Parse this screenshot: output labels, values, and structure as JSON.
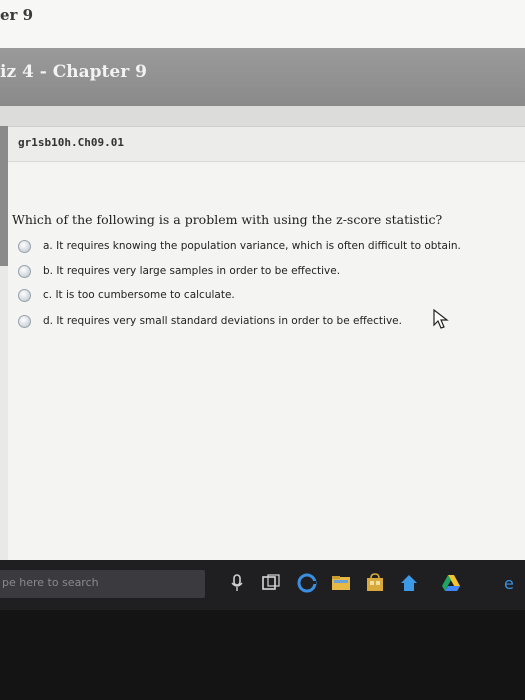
{
  "window": {
    "title_fragment": "er 9",
    "banner_title": "iz 4 - Chapter 9"
  },
  "question": {
    "id": "gr1sb10h.Ch09.01",
    "prompt": "Which of the following is a problem with using the z-score statistic?",
    "choices": [
      {
        "label": "a. It requires knowing the population variance, which is often difficult to obtain."
      },
      {
        "label": "b. It requires very large samples in order to be effective."
      },
      {
        "label": "c. It is too cumbersome to calculate."
      },
      {
        "label": "d. It requires very small standard deviations in order to be effective."
      }
    ]
  },
  "taskbar": {
    "search_placeholder": "pe here to search",
    "icons": [
      "microphone-icon",
      "task-view-icon",
      "edge-browser-icon",
      "file-explorer-icon",
      "store-icon",
      "home-icon",
      "drive-icon",
      "edge-icon"
    ]
  },
  "colors": {
    "banner": "#8f8f8f",
    "taskbar": "#1f1f22",
    "radio": "#cdd4dc"
  }
}
